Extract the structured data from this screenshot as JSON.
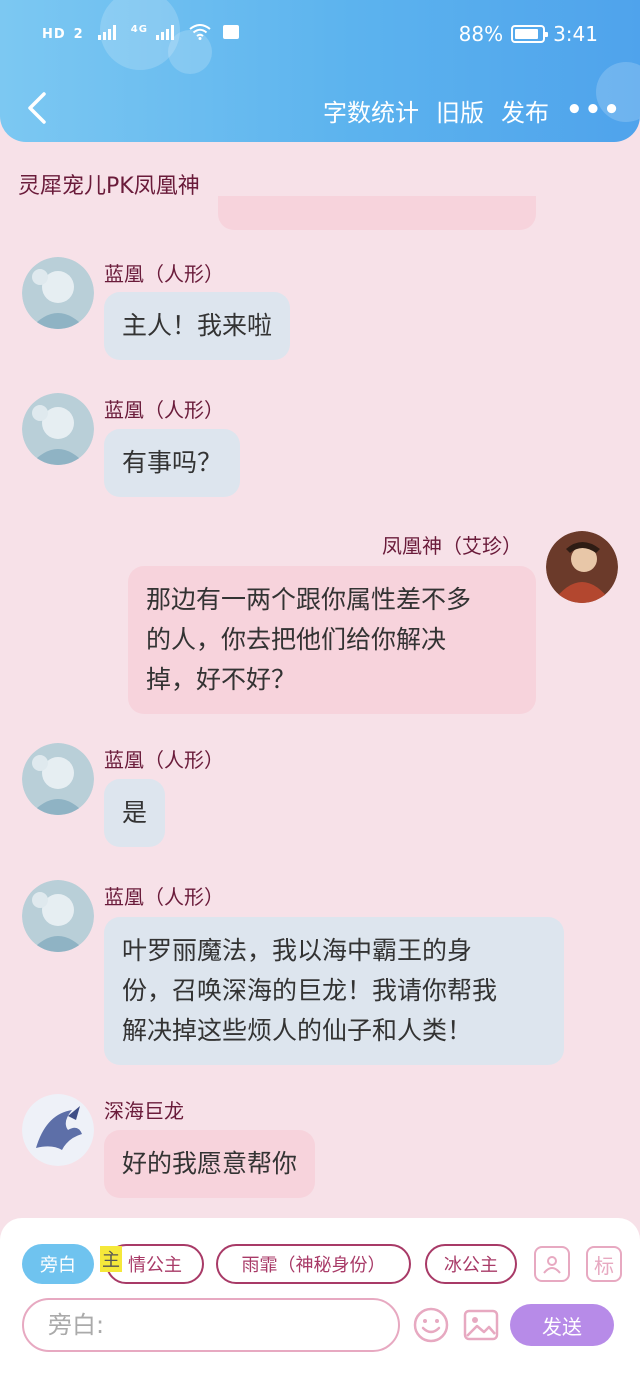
{
  "status_bar": {
    "indicators": [
      "HD",
      "2",
      "4G"
    ],
    "battery_percent": "88%",
    "battery_level": 0.88,
    "time": "3:41"
  },
  "toolbar": {
    "word_count_label": "字数统计",
    "old_version_label": "旧版",
    "publish_label": "发布",
    "more_label": "•••"
  },
  "chat": {
    "title": "灵犀宠儿PK凤凰神",
    "messages": [
      {
        "speaker": "蓝凰（人形）",
        "text": "主人！我来啦",
        "side": "left",
        "color": "blue"
      },
      {
        "speaker": "蓝凰（人形）",
        "text": "有事吗？",
        "side": "left",
        "color": "blue"
      },
      {
        "speaker": "凤凰神（艾珍）",
        "lines": [
          "那边有一两个跟你属性差不多",
          "的人，你去把他们给你解决",
          "掉，好不好？"
        ],
        "side": "right",
        "color": "pink"
      },
      {
        "speaker": "蓝凰（人形）",
        "text": "是",
        "side": "left",
        "color": "blue"
      },
      {
        "speaker": "蓝凰（人形）",
        "lines": [
          "叶罗丽魔法，我以海中霸王的身",
          "份，召唤深海的巨龙！我请你帮我",
          "解决掉这些烦人的仙子和人类！"
        ],
        "side": "left",
        "color": "blue"
      },
      {
        "speaker": "深海巨龙",
        "text": "好的我愿意帮你",
        "side": "left",
        "color": "pink"
      }
    ]
  },
  "input_panel": {
    "role_chips": [
      "旁白",
      "情公主",
      "雨霏（神秘身份）",
      "冰公主"
    ],
    "highlight_char": "主",
    "role_icon_label": "标",
    "input_placeholder": "旁白:",
    "send_label": "发送"
  },
  "colors": {
    "header_gradient_start": "#7cc8f2",
    "header_gradient_end": "#4fa3ec",
    "page_background": "#f7e1e8",
    "bubble_blue": "#dde5ee",
    "bubble_pink": "#f7d3dc",
    "name_color": "#6a1b3a",
    "send_button": "#b78be8"
  }
}
